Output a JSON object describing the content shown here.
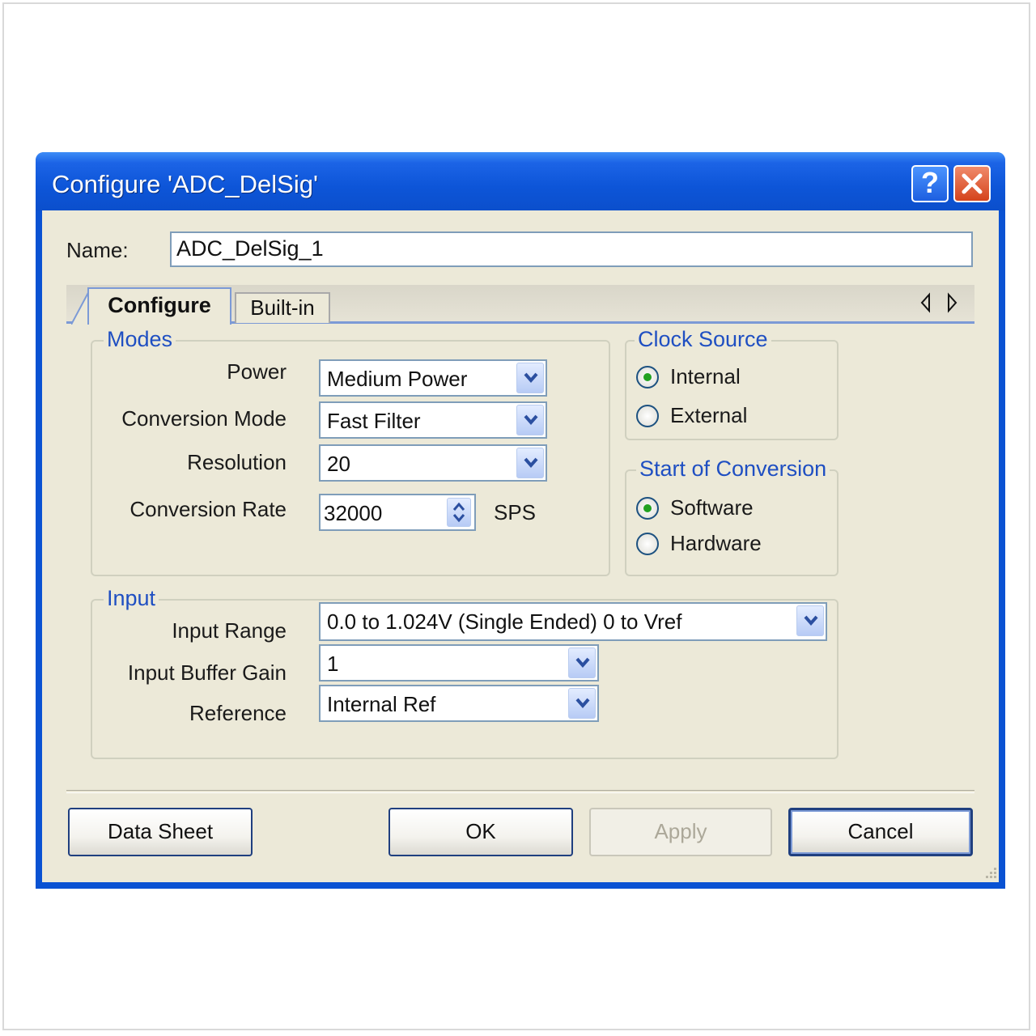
{
  "window": {
    "title": "Configure 'ADC_DelSig'"
  },
  "name_field": {
    "label": "Name:",
    "value": "ADC_DelSig_1"
  },
  "tabs": [
    {
      "label": "Configure",
      "active": true
    },
    {
      "label": "Built-in",
      "active": false
    }
  ],
  "modes": {
    "title": "Modes",
    "power": {
      "label": "Power",
      "value": "Medium Power"
    },
    "conversion_mode": {
      "label": "Conversion Mode",
      "value": "Fast Filter"
    },
    "resolution": {
      "label": "Resolution",
      "value": "20"
    },
    "conversion_rate": {
      "label": "Conversion Rate",
      "value": "32000",
      "unit": "SPS"
    }
  },
  "clock_source": {
    "title": "Clock Source",
    "options": [
      {
        "label": "Internal",
        "selected": true
      },
      {
        "label": "External",
        "selected": false
      }
    ]
  },
  "start_of_conversion": {
    "title": "Start of Conversion",
    "options": [
      {
        "label": "Software",
        "selected": true
      },
      {
        "label": "Hardware",
        "selected": false
      }
    ]
  },
  "input": {
    "title": "Input",
    "input_range": {
      "label": "Input Range",
      "value": "0.0 to 1.024V (Single Ended) 0 to Vref"
    },
    "input_buffer_gain": {
      "label": "Input Buffer Gain",
      "value": "1"
    },
    "reference": {
      "label": "Reference",
      "value": "Internal Ref"
    }
  },
  "buttons": {
    "data_sheet": "Data Sheet",
    "ok": "OK",
    "apply": "Apply",
    "cancel": "Cancel"
  },
  "colors": {
    "titlebar": "#0b4fcc",
    "client_bg": "#ece9d8",
    "group_title": "#1f4fc2",
    "radio_selected": "#21a121"
  }
}
